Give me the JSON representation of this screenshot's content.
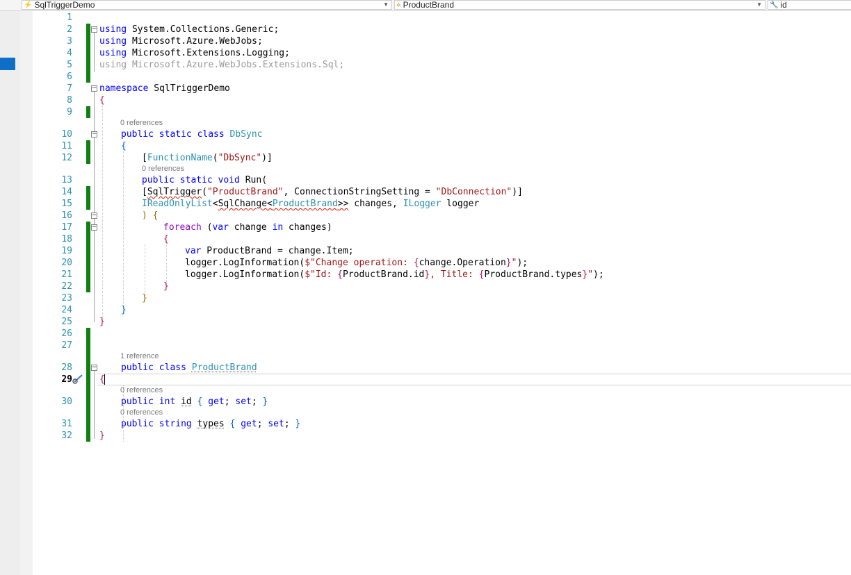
{
  "navbar": {
    "project": "SqlTriggerDemo",
    "type_member": "ProductBrand",
    "member": "id"
  },
  "editor": {
    "current_line": 29,
    "lines": [
      {
        "n": 1,
        "text": ""
      },
      {
        "n": 2,
        "text": "using System.Collections.Generic;"
      },
      {
        "n": 3,
        "text": "using Microsoft.Azure.WebJobs;"
      },
      {
        "n": 4,
        "text": "using Microsoft.Extensions.Logging;"
      },
      {
        "n": 5,
        "text": "using Microsoft.Azure.WebJobs.Extensions.Sql;"
      },
      {
        "n": 6,
        "text": ""
      },
      {
        "n": 7,
        "text": "namespace SqlTriggerDemo"
      },
      {
        "n": 8,
        "text": "{"
      },
      {
        "n": 9,
        "text": ""
      },
      {
        "n": 10,
        "text": "public static class DbSync",
        "lens": "0 references"
      },
      {
        "n": 11,
        "text": "{"
      },
      {
        "n": 12,
        "text": "[FunctionName(\"DbSync\")]"
      },
      {
        "n": 13,
        "text": "public static void Run(",
        "lens": "0 references"
      },
      {
        "n": 14,
        "text": "[SqlTrigger(\"ProductBrand\", ConnectionStringSetting = \"DbConnection\")]"
      },
      {
        "n": 15,
        "text": "IReadOnlyList<SqlChange<ProductBrand>> changes, ILogger logger"
      },
      {
        "n": 16,
        "text": ") {"
      },
      {
        "n": 17,
        "text": "foreach (var change in changes)"
      },
      {
        "n": 18,
        "text": "{"
      },
      {
        "n": 19,
        "text": "var ProductBrand = change.Item;"
      },
      {
        "n": 20,
        "text": "logger.LogInformation($\"Change operation: {change.Operation}\");"
      },
      {
        "n": 21,
        "text": "logger.LogInformation($\"Id: {ProductBrand.id}, Title: {ProductBrand.types}\");"
      },
      {
        "n": 22,
        "text": "}"
      },
      {
        "n": 23,
        "text": "}"
      },
      {
        "n": 24,
        "text": "}"
      },
      {
        "n": 25,
        "text": "}"
      },
      {
        "n": 26,
        "text": ""
      },
      {
        "n": 27,
        "text": ""
      },
      {
        "n": 28,
        "text": "public class ProductBrand",
        "lens": "1 reference"
      },
      {
        "n": 29,
        "text": "{"
      },
      {
        "n": 30,
        "text": "public int id { get; set; }",
        "lens": "0 references"
      },
      {
        "n": 31,
        "text": "public string types { get; set; }",
        "lens": "0 references"
      },
      {
        "n": 32,
        "text": "}"
      }
    ]
  }
}
